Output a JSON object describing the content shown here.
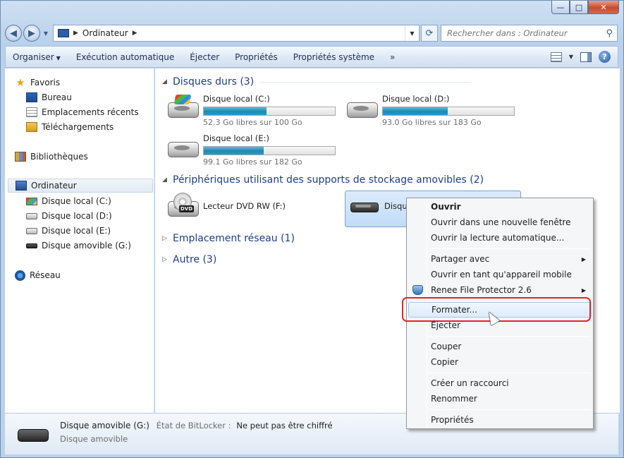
{
  "window": {
    "caption_buttons": {
      "minimize": "—",
      "maximize": "□",
      "close": "✕"
    }
  },
  "address": {
    "back_icon": "arrow-left",
    "forward_icon": "arrow-right",
    "location": "Ordinateur",
    "search_placeholder": "Rechercher dans : Ordinateur"
  },
  "toolbar": {
    "items": [
      "Organiser",
      "Exécution automatique",
      "Éjecter",
      "Propriétés",
      "Propriétés système"
    ],
    "more": "»"
  },
  "sidebar": {
    "favorites_title": "Favoris",
    "favorites": [
      "Bureau",
      "Emplacements récents",
      "Téléchargements"
    ],
    "libraries": "Bibliothèques",
    "computer": "Ordinateur",
    "drives": [
      "Disque local (C:)",
      "Disque local (D:)",
      "Disque local (E:)",
      "Disque amovible (G:)"
    ],
    "network": "Réseau"
  },
  "content": {
    "groups": {
      "hard_disks": "Disques durs (3)",
      "removable": "Périphériques utilisant des supports de stockage amovibles (2)",
      "network": "Emplacement réseau (1)",
      "other": "Autre (3)"
    },
    "hdd": [
      {
        "name": "Disque local (C:)",
        "free": "52.3 Go libres sur 100 Go",
        "used_fraction": 0.477
      },
      {
        "name": "Disque local (D:)",
        "free": "93.0 Go libres sur 183 Go",
        "used_fraction": 0.492
      },
      {
        "name": "Disque local (E:)",
        "free": "99.1 Go libres sur 182 Go",
        "used_fraction": 0.455
      }
    ],
    "removable": [
      {
        "name": "Lecteur DVD RW (F:)",
        "badge": "DVD"
      },
      {
        "name": "Disqu"
      }
    ]
  },
  "details": {
    "name": "Disque amovible (G:)",
    "bitlocker_label": "État de BitLocker :",
    "bitlocker_value": "Ne peut pas être chiffré",
    "type": "Disque amovible"
  },
  "context_menu": {
    "items": [
      "Ouvrir",
      "Ouvrir dans une nouvelle fenêtre",
      "Ouvrir la lecture automatique...",
      "Partager avec",
      "Ouvrir en tant qu'appareil mobile",
      "Renee File Protector 2.6",
      "Formater...",
      "Éjecter",
      "Couper",
      "Copier",
      "Créer un raccourci",
      "Renommer",
      "Propriétés"
    ],
    "highlighted": "Formater...",
    "highlight_color": "#e0262a"
  }
}
